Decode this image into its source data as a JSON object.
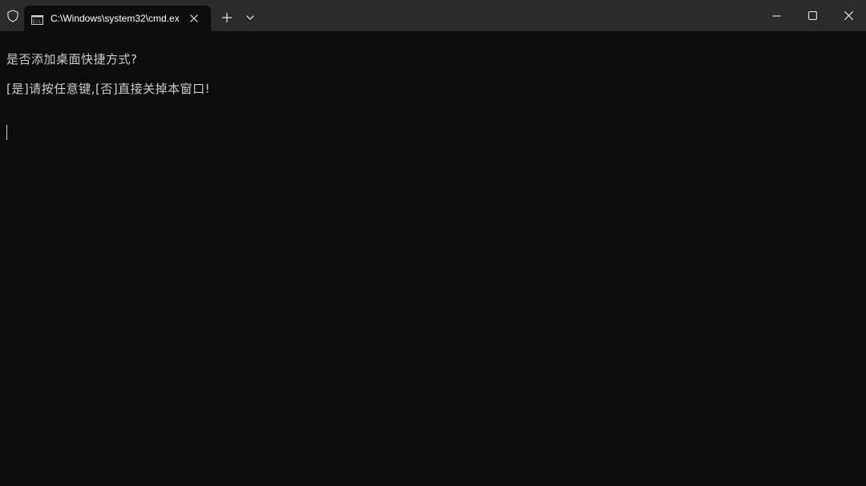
{
  "titlebar": {
    "tab_title": "C:\\Windows\\system32\\cmd.ex",
    "icons": {
      "shield": "shield-icon",
      "tab": "cmd-icon",
      "tab_close": "close-icon",
      "new_tab": "plus-icon",
      "dropdown": "chevron-down-icon",
      "minimize": "minimize-icon",
      "maximize": "maximize-icon",
      "close": "close-icon"
    }
  },
  "console": {
    "lines": [
      "是否添加桌面快捷方式?",
      "[是]请按任意键,[否]直接关掉本窗口!"
    ]
  },
  "colors": {
    "titlebar_bg": "#2b2b2b",
    "console_bg": "#0c0c0c",
    "console_text": "#cccccc",
    "tab_text": "#ffffff"
  }
}
